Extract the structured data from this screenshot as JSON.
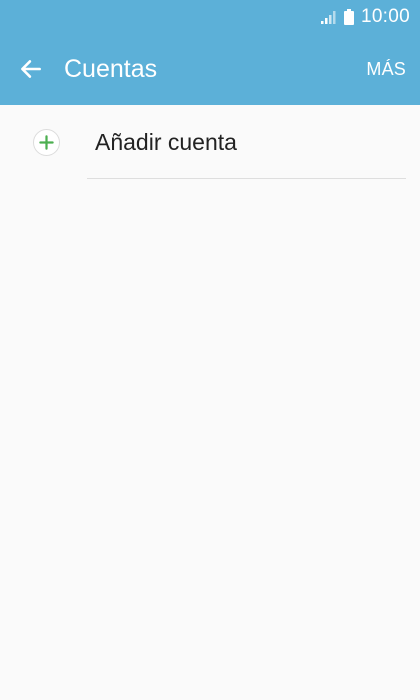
{
  "status_bar": {
    "time": "10:00",
    "icons": [
      "signal-icon",
      "battery-icon"
    ]
  },
  "app_bar": {
    "back_icon": "arrow-left-icon",
    "title": "Cuentas",
    "more_label": "MÁS"
  },
  "list": {
    "items": [
      {
        "icon": "plus-icon",
        "label": "Añadir cuenta"
      }
    ]
  },
  "colors": {
    "header": "#5cb0d8",
    "background": "#fafafa",
    "plus_icon": "#4caf50",
    "text": "#222222"
  }
}
